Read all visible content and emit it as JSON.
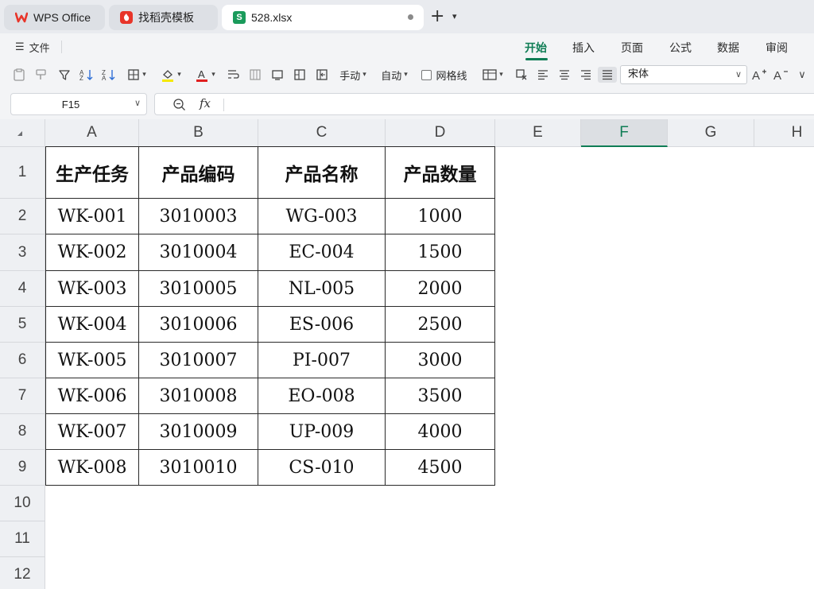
{
  "tabs": [
    {
      "label": "WPS Office",
      "icon": "wps-logo-icon"
    },
    {
      "label": "找稻壳模板",
      "icon": "docer-icon"
    },
    {
      "label": "528.xlsx",
      "icon": "spreadsheet-s-icon",
      "icon_text": "S",
      "active": true
    }
  ],
  "menu": {
    "file_label": "文件",
    "ribbon_tabs": [
      "开始",
      "插入",
      "页面",
      "公式",
      "数据",
      "审阅"
    ],
    "active_tab": "开始"
  },
  "toolbar": {
    "manual_label": "手动",
    "auto_label": "自动",
    "gridlines_label": "网格线",
    "font_name": "宋体",
    "highlight_color": "#f5e900",
    "font_color": "#e02020"
  },
  "formula_bar": {
    "name_box": "F15",
    "fx_label": "fx",
    "content": ""
  },
  "sheet": {
    "columns": [
      "A",
      "B",
      "C",
      "D",
      "E",
      "F",
      "G",
      "H"
    ],
    "selected_column": "F",
    "rows": [
      "1",
      "2",
      "3",
      "4",
      "5",
      "6",
      "7",
      "8",
      "9",
      "10",
      "11",
      "12"
    ],
    "table": {
      "headers": [
        "生产任务",
        "产品编码",
        "产品名称",
        "产品数量"
      ],
      "rows": [
        [
          "WK-001",
          "3010003",
          "WG-003",
          "1000"
        ],
        [
          "WK-002",
          "3010004",
          "EC-004",
          "1500"
        ],
        [
          "WK-003",
          "3010005",
          "NL-005",
          "2000"
        ],
        [
          "WK-004",
          "3010006",
          "ES-006",
          "2500"
        ],
        [
          "WK-005",
          "3010007",
          "PI-007",
          "3000"
        ],
        [
          "WK-006",
          "3010008",
          "EO-008",
          "3500"
        ],
        [
          "WK-007",
          "3010009",
          "UP-009",
          "4000"
        ],
        [
          "WK-008",
          "3010010",
          "CS-010",
          "4500"
        ]
      ]
    }
  },
  "colors": {
    "accent": "#0f7d55",
    "wps_red": "#e8352a",
    "sheet_green": "#1a9b5b"
  }
}
